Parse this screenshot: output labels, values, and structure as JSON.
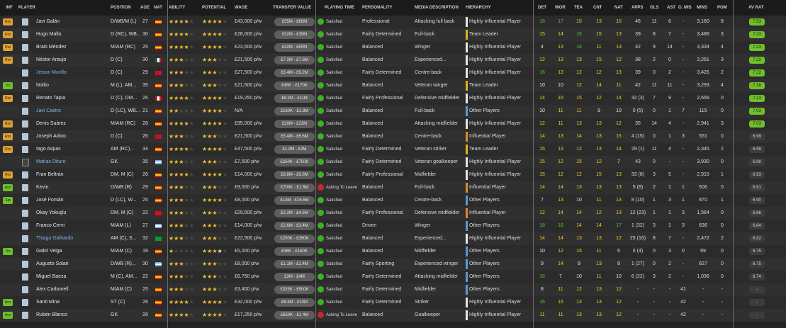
{
  "headers": {
    "inf": "INF",
    "player": "PLAYER",
    "position": "POSITION",
    "age": "AGE",
    "nat": "NAT",
    "ability": "ABILITY",
    "potential": "POTENTIAL",
    "wage": "WAGE",
    "transfer_value": "TRANSFER VALUE",
    "playing_time": "PLAYING TIME",
    "personality": "PERSONALITY",
    "media_description": "MEDIA DESCRIPTION",
    "hierarchy": "HIERARCHY",
    "det": "DET",
    "wor": "WOR",
    "tea": "TEA",
    "cnt": "CNT",
    "nat2": "NAT",
    "apps": "APPS",
    "gls": "GLS",
    "ast": "AST",
    "gmis": "G. MIS",
    "mins": "MINS",
    "pom": "POM",
    "avrat": "AV RAT"
  },
  "colors": {
    "badge_rot": "#e0a030",
    "badge_pick": "#e0a030",
    "badge_green": "#6fbf2a",
    "rating_green": "#6fbf2a"
  },
  "rows": [
    {
      "inf": "Rot",
      "inf_color": "#e0a030",
      "name": "Javi Galán",
      "loan": false,
      "position": "D/WB/M (L)",
      "age": "27",
      "nat": "es",
      "ability": 4,
      "potential": 4,
      "pot_half": false,
      "wage": "£43,000 p/w",
      "tv": "£55M - £60M",
      "pt": "Satisfied",
      "pt_bad": false,
      "personality": "Professional",
      "media": "Attacking full back",
      "hierarchy": "Highly Influential Player",
      "hcolor": "w",
      "det": "16",
      "wor": "17",
      "tea": "15",
      "cnt": "13",
      "nat2": "15",
      "apps": "46",
      "gls": "11",
      "ast": "6",
      "gmis": "-",
      "mins": "3,160",
      "pom": "8",
      "avrat": "7.53",
      "rating_green": true
    },
    {
      "inf": "Rot",
      "inf_color": "#e0a030",
      "name": "Hugo Mallo",
      "loan": false,
      "position": "D (RC), WB...",
      "age": "30",
      "nat": "es",
      "ability": 4,
      "potential": 4,
      "pot_half": false,
      "wage": "£28,000 p/w",
      "tv": "£32M - £39M",
      "pt": "Satisfied",
      "pt_bad": false,
      "personality": "Fairly Determined",
      "media": "Full-back",
      "hierarchy": "Team Leader",
      "hcolor": "gold",
      "det": "15",
      "wor": "14",
      "tea": "16",
      "cnt": "15",
      "nat2": "13",
      "apps": "39",
      "gls": "8",
      "ast": "7",
      "gmis": "-",
      "mins": "3,486",
      "pom": "3",
      "avrat": "7.33",
      "rating_green": true
    },
    {
      "inf": "Rot",
      "inf_color": "#e0a030",
      "name": "Brais Méndez",
      "loan": false,
      "position": "M/AM (RC)",
      "age": "25",
      "nat": "es",
      "ability": 4,
      "potential": 4,
      "pot_half": false,
      "wage": "£23,500 p/w",
      "tv": "£42M - £50M",
      "pt": "Satisfied",
      "pt_bad": false,
      "personality": "Balanced",
      "media": "Winger",
      "hierarchy": "Highly Influential Player",
      "hcolor": "w",
      "det": "4",
      "wor": "13",
      "tea": "16",
      "cnt": "11",
      "nat2": "13",
      "apps": "42",
      "gls": "9",
      "ast": "14",
      "gmis": "-",
      "mins": "3,334",
      "pom": "4",
      "avrat": "7.23",
      "rating_green": true
    },
    {
      "inf": "Rot",
      "inf_color": "#e0a030",
      "name": "Néstor Araujo",
      "loan": false,
      "position": "D (C)",
      "age": "30",
      "nat": "mx",
      "ability": 3,
      "potential": 3,
      "pot_half": false,
      "wage": "£21,500 p/w",
      "tv": "£7.2M - £7.8M",
      "pt": "Satisfied",
      "pt_bad": false,
      "personality": "Balanced",
      "media": "Experienced...",
      "hierarchy": "Highly Influential Player",
      "hcolor": "w",
      "det": "12",
      "wor": "13",
      "tea": "13",
      "cnt": "15",
      "nat2": "12",
      "apps": "38",
      "gls": "2",
      "ast": "0",
      "gmis": "-",
      "mins": "3,261",
      "pom": "3",
      "avrat": "7.22",
      "rating_green": true
    },
    {
      "inf": "",
      "inf_color": "",
      "name": "Jeison Murillo",
      "loan": true,
      "position": "D (C)",
      "age": "29",
      "nat": "co",
      "ability": 3,
      "potential": 3,
      "pot_half": false,
      "wage": "£27,500 p/w",
      "tv": "£6.4M - £9.2M",
      "pt": "Satisfied",
      "pt_bad": false,
      "personality": "Fairly Determined",
      "media": "Centre-back",
      "hierarchy": "Highly Influential Player",
      "hcolor": "w",
      "det": "16",
      "wor": "13",
      "tea": "12",
      "cnt": "12",
      "nat2": "13",
      "apps": "39",
      "gls": "0",
      "ast": "2",
      "gmis": "-",
      "mins": "3,426",
      "pom": "2",
      "avrat": "7.22",
      "rating_green": true
    },
    {
      "inf": "Trn",
      "inf_color": "#6fbf2a",
      "name": "Nolito",
      "loan": false,
      "position": "M (L), AM...",
      "age": "35",
      "nat": "es",
      "ability": 3,
      "potential": 3,
      "pot_half": false,
      "wage": "£21,500 p/w",
      "tv": "£45K - £170K",
      "pt": "Satisfied",
      "pt_bad": false,
      "personality": "Balanced",
      "media": "Veteran winger",
      "hierarchy": "Team Leader",
      "hcolor": "gold",
      "det": "10",
      "wor": "10",
      "tea": "12",
      "cnt": "14",
      "nat2": "11",
      "apps": "42",
      "gls": "11",
      "ast": "11",
      "gmis": "-",
      "mins": "3,293",
      "pom": "4",
      "avrat": "7.16",
      "rating_green": true
    },
    {
      "inf": "Rot",
      "inf_color": "#e0a030",
      "name": "Renato Tapia",
      "loan": false,
      "position": "D (C), DM...",
      "age": "26",
      "nat": "pe",
      "ability": 4,
      "potential": 4,
      "pot_half": false,
      "wage": "£19,250 p/w",
      "tv": "£9.2M - £11M",
      "pt": "Satisfied",
      "pt_bad": false,
      "personality": "Fairly Professional",
      "media": "Defensive midfielder",
      "hierarchy": "Highly Influential Player",
      "hcolor": "w",
      "det": "14",
      "wor": "15",
      "tea": "15",
      "cnt": "12",
      "nat2": "14",
      "apps": "32 (3)",
      "gls": "7",
      "ast": "9",
      "gmis": "-",
      "mins": "2,656",
      "pom": "0",
      "avrat": "7.13",
      "rating_green": true
    },
    {
      "inf": "",
      "inf_color": "",
      "name": "Javi Castro",
      "loan": true,
      "position": "D (LC), WB...",
      "age": "21",
      "nat": "es",
      "ability": 2,
      "potential": 4,
      "pot_half": false,
      "wage": "N/A",
      "tv": "£160K - £1.8M",
      "pt": "Satisfied",
      "pt_bad": false,
      "personality": "Balanced",
      "media": "Full-back",
      "hierarchy": "Other Players",
      "hcolor": "blue",
      "det": "10",
      "wor": "11",
      "tea": "11",
      "cnt": "9",
      "nat2": "10",
      "apps": "0 (5)",
      "gls": "0",
      "ast": "1",
      "gmis": "7",
      "mins": "115",
      "pom": "0",
      "avrat": "7.03",
      "rating_green": true
    },
    {
      "inf": "Rot",
      "inf_color": "#e0a030",
      "name": "Denis Suárez",
      "loan": false,
      "position": "M/AM (RC)",
      "age": "28",
      "nat": "es",
      "ability": 4,
      "potential": 4,
      "pot_half": false,
      "wage": "£95,000 p/w",
      "tv": "£20M - £22M",
      "pt": "Satisfied",
      "pt_bad": false,
      "personality": "Balanced",
      "media": "Attacking midfielder",
      "hierarchy": "Highly Influential Player",
      "hcolor": "w",
      "det": "12",
      "wor": "11",
      "tea": "13",
      "cnt": "13",
      "nat2": "12",
      "apps": "35",
      "gls": "14",
      "ast": "4",
      "gmis": "-",
      "mins": "2,941",
      "pom": "3",
      "avrat": "7.03",
      "rating_green": true
    },
    {
      "inf": "Rot",
      "inf_color": "#e0a030",
      "name": "Joseph Aidoo",
      "loan": false,
      "position": "D (C)",
      "age": "26",
      "nat": "gh",
      "ability": 3,
      "potential": 3,
      "pot_half": false,
      "wage": "£21,500 p/w",
      "tv": "£5.4M - £6.6M",
      "pt": "Satisfied",
      "pt_bad": false,
      "personality": "Balanced",
      "media": "Centre-back",
      "hierarchy": "Influential Player",
      "hcolor": "orange",
      "det": "14",
      "wor": "13",
      "tea": "14",
      "cnt": "13",
      "nat2": "15",
      "apps": "4 (15)",
      "gls": "0",
      "ast": "1",
      "gmis": "3",
      "mins": "551",
      "pom": "0",
      "avrat": "6.99",
      "rating_green": false
    },
    {
      "inf": "Rot",
      "inf_color": "#e0a030",
      "name": "Iago Aspas",
      "loan": false,
      "position": "AM (RC)...",
      "age": "34",
      "nat": "es",
      "ability": 4,
      "potential": 4,
      "pot_half": false,
      "wage": "£47,500 p/w",
      "tv": "£1.9M - £3M",
      "pt": "Satisfied",
      "pt_bad": false,
      "personality": "Fairly Determined",
      "media": "Veteran striker",
      "hierarchy": "Team Leader",
      "hcolor": "gold",
      "det": "15",
      "wor": "13",
      "tea": "12",
      "cnt": "13",
      "nat2": "14",
      "apps": "29 (1)",
      "gls": "11",
      "ast": "4",
      "gmis": "-",
      "mins": "2,345",
      "pom": "2",
      "avrat": "6.99",
      "rating_green": false
    },
    {
      "inf": "",
      "inf_color": "",
      "name": "Matías Dituro",
      "loan": true,
      "position": "GK",
      "age": "35",
      "nat": "ar",
      "ability": 3,
      "potential": 3,
      "pot_half": false,
      "wage": "£7,500 p/w",
      "tv": "£250K - £750K",
      "pt": "Satisfied",
      "pt_bad": false,
      "personality": "Fairly Determined",
      "media": "Veteran goalkeeper",
      "hierarchy": "Highly Influential Player",
      "hcolor": "w",
      "det": "15",
      "wor": "12",
      "tea": "15",
      "cnt": "12",
      "nat2": "7",
      "apps": "43",
      "gls": "0",
      "ast": "-",
      "gmis": "-",
      "mins": "3,930",
      "pom": "0",
      "avrat": "6.99",
      "rating_green": false
    },
    {
      "inf": "Rot",
      "inf_color": "#e0a030",
      "name": "Fran Beltrán",
      "loan": false,
      "position": "DM, M (C)",
      "age": "26",
      "nat": "es",
      "ability": 4,
      "potential": 4,
      "pot_half": false,
      "wage": "£14,000 p/w",
      "tv": "£8.8M - £9.8M",
      "pt": "Satisfied",
      "pt_bad": false,
      "personality": "Fairly Professional",
      "media": "Midfielder",
      "hierarchy": "Highly Influential Player",
      "hcolor": "w",
      "det": "15",
      "wor": "12",
      "tea": "12",
      "cnt": "15",
      "nat2": "13",
      "apps": "33 (8)",
      "gls": "3",
      "ast": "5",
      "gmis": "-",
      "mins": "2,915",
      "pom": "1",
      "avrat": "6.93",
      "rating_green": false
    },
    {
      "inf": "Avn",
      "inf_color": "#6fbf2a",
      "name": "Kevin",
      "loan": false,
      "position": "D/WB (R)",
      "age": "29",
      "nat": "es",
      "ability": 3,
      "potential": 3,
      "pot_half": false,
      "wage": "£9,000 p/w",
      "tv": "£700K - £1.5M",
      "pt": "Asking To Leave",
      "pt_bad": true,
      "personality": "Balanced",
      "media": "Full-back",
      "hierarchy": "Influential Player",
      "hcolor": "orange",
      "det": "14",
      "wor": "14",
      "tea": "13",
      "cnt": "13",
      "nat2": "13",
      "apps": "5 (8)",
      "gls": "2",
      "ast": "1",
      "gmis": "1",
      "mins": "506",
      "pom": "0",
      "avrat": "6.91",
      "rating_green": false
    },
    {
      "inf": "Spt",
      "inf_color": "#6fbf2a",
      "name": "José Fontán",
      "loan": false,
      "position": "D (LC), W...",
      "age": "25",
      "nat": "es",
      "ability": 3,
      "potential": 4,
      "pot_half": false,
      "wage": "£8,000 p/w",
      "tv": "£14M - £15.5M",
      "pt": "Satisfied",
      "pt_bad": false,
      "personality": "Balanced",
      "media": "Centre-back",
      "hierarchy": "Other Players",
      "hcolor": "blue",
      "det": "7",
      "wor": "13",
      "tea": "10",
      "cnt": "11",
      "nat2": "13",
      "apps": "8 (10)",
      "gls": "1",
      "ast": "3",
      "gmis": "1",
      "mins": "870",
      "pom": "1",
      "avrat": "6.90",
      "rating_green": false
    },
    {
      "inf": "",
      "inf_color": "",
      "name": "Okay Yokuşlu",
      "loan": false,
      "position": "DM, M (C)",
      "age": "22",
      "nat": "tr",
      "ability": 3,
      "potential": 3,
      "pot_half": false,
      "wage": "£29,500 p/w",
      "tv": "£2.2M - £4.6M",
      "pt": "Satisfied",
      "pt_bad": false,
      "personality": "Fairly Professional",
      "media": "Defensive midfielder",
      "hierarchy": "Influential Player",
      "hcolor": "orange",
      "det": "12",
      "wor": "14",
      "tea": "14",
      "cnt": "12",
      "nat2": "13",
      "apps": "12 (23)",
      "gls": "1",
      "ast": "1",
      "gmis": "3",
      "mins": "1,564",
      "pom": "0",
      "avrat": "6.86",
      "rating_green": false
    },
    {
      "inf": "",
      "inf_color": "",
      "name": "Franco Cervi",
      "loan": false,
      "position": "M/AM (L)",
      "age": "27",
      "nat": "ar",
      "ability": 3,
      "potential": 3,
      "pot_half": false,
      "wage": "£14,000 p/w",
      "tv": "£2.6M - £3.4M",
      "pt": "Satisfied",
      "pt_bad": false,
      "personality": "Driven",
      "media": "Winger",
      "hierarchy": "Other Players",
      "hcolor": "blue",
      "det": "18",
      "wor": "18",
      "tea": "14",
      "cnt": "14",
      "nat2": "17",
      "apps": "1 (32)",
      "gls": "3",
      "ast": "1",
      "gmis": "3",
      "mins": "636",
      "pom": "0",
      "avrat": "6.84",
      "rating_green": false
    },
    {
      "inf": "",
      "inf_color": "",
      "name": "Thiago Galhardo",
      "loan": true,
      "position": "AM (C), S...",
      "age": "32",
      "nat": "br",
      "ability": 3,
      "potential": 3,
      "pot_half": false,
      "wage": "£22,500 p/w",
      "tv": "£200K - £350K",
      "pt": "Satisfied",
      "pt_bad": false,
      "personality": "Balanced",
      "media": "Experienced...",
      "hierarchy": "Highly Influential Player",
      "hcolor": "w",
      "det": "14",
      "wor": "14",
      "tea": "13",
      "cnt": "13",
      "nat2": "12",
      "apps": "25 (16)",
      "gls": "8",
      "ast": "7",
      "gmis": "-",
      "mins": "2,472",
      "pom": "2",
      "avrat": "6.82",
      "rating_green": false
    },
    {
      "inf": "Trn",
      "inf_color": "#6fbf2a",
      "name": "Gabri Veiga",
      "loan": false,
      "position": "M/AM (C)",
      "age": "19",
      "nat": "es",
      "ability": 1,
      "potential": 3,
      "pot_half": true,
      "wage": "£5,000 p/w",
      "tv": "£36K - £160K",
      "pt": "Satisfied",
      "pt_bad": false,
      "personality": "Balanced",
      "media": "Midfielder",
      "hierarchy": "Other Players",
      "hcolor": "blue",
      "det": "10",
      "wor": "12",
      "tea": "15",
      "cnt": "11",
      "nat2": "5",
      "apps": "0 (4)",
      "gls": "0",
      "ast": "3",
      "gmis": "0",
      "mins": "69",
      "pom": "0",
      "avrat": "6.75",
      "rating_green": false
    },
    {
      "inf": "",
      "inf_color": "",
      "name": "Augusto Solari",
      "loan": false,
      "position": "D/WB (R)...",
      "age": "30",
      "nat": "ar",
      "ability": 3,
      "potential": 3,
      "pot_half": false,
      "wage": "£8,000 p/w",
      "tv": "£1.1M - £1.4M",
      "pt": "Satisfied",
      "pt_bad": false,
      "personality": "Fairly Sporting",
      "media": "Experienced winger",
      "hierarchy": "Other Players",
      "hcolor": "blue",
      "det": "9",
      "wor": "14",
      "tea": "9",
      "cnt": "13",
      "nat2": "9",
      "apps": "1 (27)",
      "gls": "0",
      "ast": "2",
      "gmis": "-",
      "mins": "627",
      "pom": "0",
      "avrat": "6.75",
      "rating_green": false
    },
    {
      "inf": "",
      "inf_color": "",
      "name": "Miguel Baeza",
      "loan": false,
      "position": "M (C), AM...",
      "age": "22",
      "nat": "es",
      "ability": 3,
      "potential": 3,
      "pot_half": false,
      "wage": "£6,750 p/w",
      "tv": "£3M - £4M",
      "pt": "Satisfied",
      "pt_bad": false,
      "personality": "Fairly Determined",
      "media": "Attacking midfielder",
      "hierarchy": "Other Players",
      "hcolor": "blue",
      "det": "16",
      "wor": "7",
      "tea": "10",
      "cnt": "11",
      "nat2": "10",
      "apps": "6 (22)",
      "gls": "3",
      "ast": "2",
      "gmis": "-",
      "mins": "1,036",
      "pom": "0",
      "avrat": "6.74",
      "rating_green": false
    },
    {
      "inf": "",
      "inf_color": "",
      "name": "Alex Carbonell",
      "loan": false,
      "position": "M/AM (C)",
      "age": "25",
      "nat": "es",
      "ability": 3,
      "potential": 3,
      "pot_half": false,
      "wage": "£3,400 p/w",
      "tv": "£325K - £500K",
      "pt": "Satisfied",
      "pt_bad": false,
      "personality": "Fairly Determined",
      "media": "Midfielder",
      "hierarchy": "Other Players",
      "hcolor": "blue",
      "det": "8",
      "wor": "11",
      "tea": "12",
      "cnt": "13",
      "nat2": "12",
      "apps": "-",
      "gls": "-",
      "ast": "-",
      "gmis": "41",
      "mins": "-",
      "pom": "-",
      "avrat": "-",
      "rating_green": false
    },
    {
      "inf": "Avn",
      "inf_color": "#6fbf2a",
      "name": "Santi Mina",
      "loan": false,
      "position": "ST (C)",
      "age": "26",
      "nat": "es",
      "ability": 4,
      "potential": 4,
      "pot_half": false,
      "wage": "£32,000 p/w",
      "tv": "£8.8M - £10M",
      "pt": "Satisfied",
      "pt_bad": false,
      "personality": "Fairly Determined",
      "media": "Striker",
      "hierarchy": "Highly Influential Player",
      "hcolor": "w",
      "det": "16",
      "wor": "15",
      "tea": "13",
      "cnt": "13",
      "nat2": "12",
      "apps": "-",
      "gls": "-",
      "ast": "-",
      "gmis": "42",
      "mins": "-",
      "pom": "-",
      "avrat": "-",
      "rating_green": false
    },
    {
      "inf": "Avn",
      "inf_color": "#6fbf2a",
      "name": "Rubén Blanco",
      "loan": false,
      "position": "GK",
      "age": "26",
      "nat": "es",
      "ability": 4,
      "potential": 4,
      "pot_half": false,
      "wage": "£17,250 p/w",
      "tv": "£650K - £1.4M",
      "pt": "Asking To Leave",
      "pt_bad": true,
      "personality": "Balanced",
      "media": "Goalkeeper",
      "hierarchy": "Highly Influential Player",
      "hcolor": "w",
      "det": "11",
      "wor": "11",
      "tea": "13",
      "cnt": "13",
      "nat2": "12",
      "apps": "-",
      "gls": "-",
      "ast": "-",
      "gmis": "42",
      "mins": "-",
      "pom": "-",
      "avrat": "-",
      "rating_green": false
    }
  ]
}
